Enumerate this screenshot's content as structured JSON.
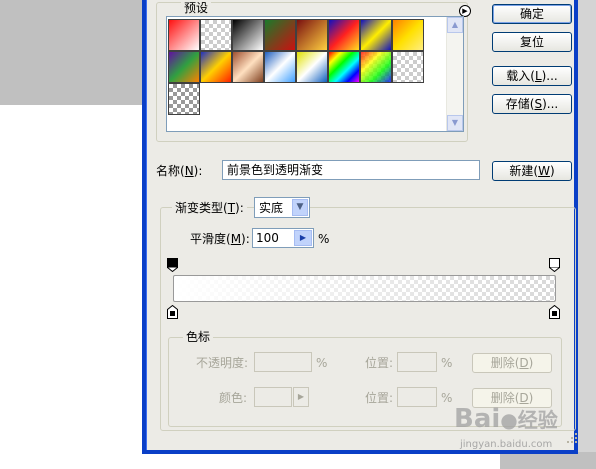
{
  "presets": {
    "legend": "预设",
    "swatches": [
      "linear-gradient(135deg,#ff1010,#ffffff)",
      "repeating-conic-gradient(#ccc 0 25%,#fff 0 50%) 0 0/8px 8px",
      "linear-gradient(135deg,#000,#fff)",
      "linear-gradient(135deg,#1a7a2a,#cc1010)",
      "linear-gradient(135deg,#7a1010,#ffd040)",
      "linear-gradient(135deg,#1010c0,#ff2020,#ffe020)",
      "linear-gradient(135deg,#1010c0,#ffee00,#1010c0)",
      "linear-gradient(135deg,#ff8000,#ffe000,#ffee80)",
      "linear-gradient(135deg,#6010a0,#30a040,#ff8000)",
      "linear-gradient(135deg,#2030c0,#ffd000,#ff2000)",
      "linear-gradient(135deg,#a05030,#ffe0c0,#804020)",
      "linear-gradient(135deg,#2060c0,#ffffff,#40a0ff)",
      "linear-gradient(135deg,#e0e000,#ffffff,#1060c0)",
      "linear-gradient(135deg,#ff0000,#ffff00,#00ff00,#00ffff,#0000ff,#ff00ff)",
      "linear-gradient(135deg,rgba(255,0,0,.8),rgba(255,255,0,.8),rgba(0,255,0,.8),rgba(0,0,255,.8)), repeating-conic-gradient(#ccc 0 25%,#fff 0 50%) 0 0/8px 8px",
      "repeating-conic-gradient(#ccc 0 25%,#fff 0 50%) 0 0/8px 8px",
      "repeating-conic-gradient(#999 0 25%,#fff 0 50%) 0 0/8px 8px"
    ]
  },
  "buttons": {
    "ok": "确定",
    "reset": "复位",
    "load": "载入(",
    "load_key": "L",
    "load_tail": ")...",
    "save": "存储(",
    "save_key": "S",
    "save_tail": ")...",
    "new": "新建(",
    "new_key": "W",
    "new_tail": ")"
  },
  "name_field": {
    "label": "名称(",
    "key": "N",
    "tail": "):",
    "value": "前景色到透明渐变"
  },
  "gradient_type": {
    "label": "渐变类型(",
    "key": "T",
    "tail": "):",
    "value": "实底"
  },
  "smoothness": {
    "label": "平滑度(",
    "key": "M",
    "tail": "):",
    "value": "100",
    "unit": "%"
  },
  "color_stops": {
    "legend": "色标",
    "opacity_label": "不透明度:",
    "opacity_unit": "%",
    "location_label": "位置:",
    "location_unit": "%",
    "delete_label": "删除(",
    "delete_key": "D",
    "delete_tail": ")",
    "color_label": "颜色:"
  },
  "watermark": {
    "brand": "Bai",
    "brand2": "经验",
    "url": "jingyan.baidu.com"
  },
  "colors": {
    "dialog_bg": "#ecebe6",
    "frame_blue": "#0a3fc7",
    "disabled_text": "#a7a69a"
  }
}
